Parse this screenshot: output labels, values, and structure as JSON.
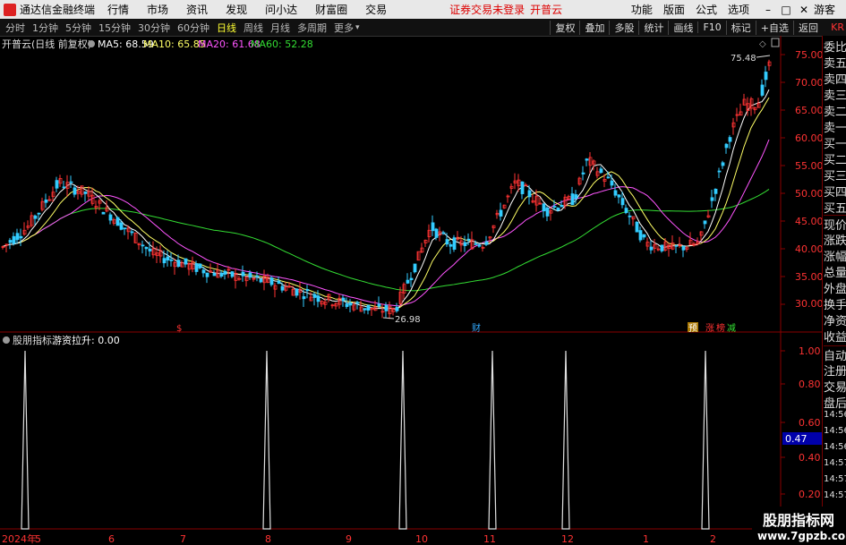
{
  "topbar": {
    "app_title": "通达信金融终端",
    "menus": [
      "行情",
      "市场",
      "资讯",
      "发现",
      "问小达",
      "财富圈",
      "交易"
    ],
    "notice": "证券交易未登录",
    "notice2": "开普云",
    "right_items": [
      "功能",
      "版面",
      "公式",
      "选项"
    ],
    "guest": "游客"
  },
  "periods": {
    "items": [
      "分时",
      "1分钟",
      "5分钟",
      "15分钟",
      "30分钟",
      "60分钟",
      "日线",
      "周线",
      "月线",
      "多周期",
      "更多"
    ],
    "active_index": 6,
    "tools": [
      "复权",
      "叠加",
      "多股",
      "统计",
      "画线",
      "F10",
      "标记",
      "+自选",
      "返回"
    ],
    "kr": "KR"
  },
  "main_chart": {
    "title": "开普云(日线 前复权)",
    "ma5_label": "MA5: 68.59",
    "ma10_label": "MA10: 65.85",
    "ma20_label": "MA20: 61.68",
    "ma60_label": "MA60: 52.28",
    "high_label": "75.48",
    "low_label": "26.98",
    "price_ticks": [
      "75.00",
      "70.00",
      "65.00",
      "60.00",
      "55.00",
      "50.00",
      "45.00",
      "40.00",
      "35.00",
      "30.00"
    ],
    "markers": [
      "$",
      "财",
      "预",
      "涨",
      "榜",
      "减"
    ],
    "colors": {
      "up": "#ff3333",
      "down": "#33ccff",
      "ma5": "#ffffff",
      "ma10": "#ffff66",
      "ma20": "#ff55ff",
      "ma60": "#33dd33"
    }
  },
  "sub_chart": {
    "title": "股朋指标",
    "value_label": "游资拉升: 0.00",
    "ticks": [
      "1.00",
      "0.80",
      "0.60",
      "0.40",
      "0.20"
    ],
    "current_value": "0.47"
  },
  "x_axis": {
    "labels": [
      "2024年",
      "5",
      "6",
      "7",
      "8",
      "9",
      "10",
      "11",
      "12",
      "1",
      "2"
    ]
  },
  "right_panel": {
    "items": [
      "委比",
      "卖五",
      "卖四",
      "卖三",
      "卖二",
      "卖一",
      "买一",
      "买二",
      "买三",
      "买四",
      "买五",
      "现价",
      "涨跌",
      "涨幅",
      "总量",
      "外盘",
      "换手",
      "净资",
      "收益",
      "自动",
      "注册",
      "交易",
      "盘后",
      "14:56",
      "14:56",
      "14:56",
      "14:57",
      "14:57",
      "14:57"
    ]
  },
  "watermark": {
    "line1": "股朋指标网",
    "line2": "www.7gpzb.com"
  }
}
